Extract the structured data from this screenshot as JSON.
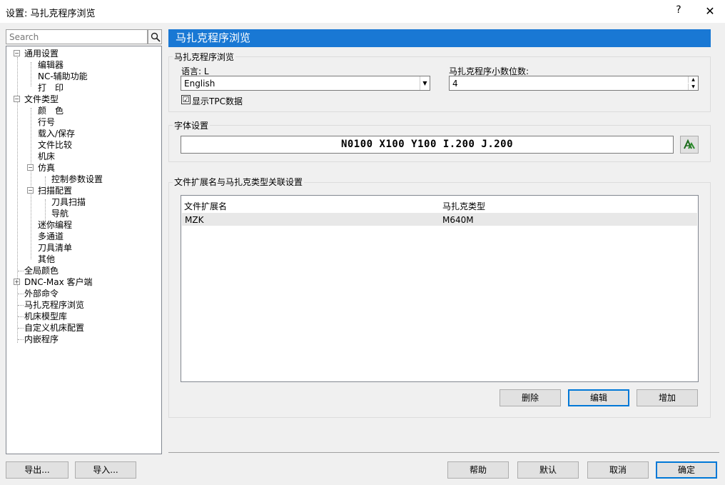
{
  "window": {
    "title": "设置: 马扎克程序浏览",
    "help_label": "?",
    "close_label": "✕"
  },
  "search": {
    "placeholder": "Search"
  },
  "tree": [
    "通用设置",
    "编辑器",
    "NC-辅助功能",
    "打　印",
    "文件类型",
    "颜　色",
    "行号",
    "载入/保存",
    "文件比较",
    "机床",
    "仿真",
    "控制参数设置",
    "扫描配置",
    "刀具扫描",
    "导航",
    "迷你编程",
    "多通道",
    "刀具清单",
    "其他",
    "全局颜色",
    "DNC-Max 客户端",
    "外部命令",
    "马扎克程序浏览",
    "机床模型库",
    "自定义机床配置",
    "内嵌程序"
  ],
  "panel": {
    "title": "马扎克程序浏览",
    "group_browse": "马扎克程序浏览",
    "language_label": "语言: L",
    "language_value": "English",
    "decimals_label": "马扎克程序小数位数:",
    "decimals_value": "4",
    "tpc_label": "显示TPC数据",
    "tpc_checked": "☑",
    "group_font": "字体设置",
    "font_preview": "N0100 X100 Y100 I.200 J.200",
    "group_assoc": "文件扩展名与马扎克类型关联设置",
    "table": {
      "headers": [
        "文件扩展名",
        "马扎克类型"
      ],
      "rows": [
        [
          "MZK",
          "M640M"
        ]
      ]
    },
    "delete_label": "删除",
    "edit_label": "编辑",
    "add_label": "增加"
  },
  "footer": {
    "export_label": "导出...",
    "import_label": "导入...",
    "help_label": "帮助",
    "default_label": "默认",
    "cancel_label": "取消",
    "ok_label": "确定"
  },
  "colors": {
    "header_bar": "#1978d4",
    "accent": "#0078d7"
  }
}
